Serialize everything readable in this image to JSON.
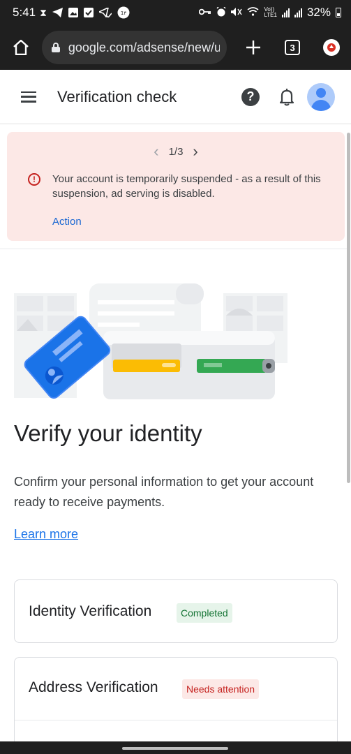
{
  "status_bar": {
    "time": "5:41",
    "volte": "Vo))\nLTE1",
    "battery_pct": "32%",
    "notification_icons": [
      "hourglass-icon",
      "telegram-icon",
      "gallery-icon",
      "checkbox-icon",
      "send-check-icon",
      "badge-icon"
    ],
    "system_icons": [
      "key-icon",
      "alarm-icon",
      "mute-icon",
      "wifi-icon",
      "signal-icon",
      "battery-icon"
    ]
  },
  "browser": {
    "url": "google.com/adsense/new/u",
    "tab_count": "3"
  },
  "app_bar": {
    "title": "Verification check"
  },
  "alert": {
    "pager": "1/3",
    "message": "Your account is temporarily suspended - as a result of this suspension, ad serving is disabled.",
    "action_label": "Action",
    "color": "#fce8e6"
  },
  "main": {
    "heading": "Verify your identity",
    "description": "Confirm your personal information to get your account ready to receive payments.",
    "learn_more": "Learn more"
  },
  "cards": [
    {
      "title": "Identity Verification",
      "status": "Completed",
      "status_color": "#137333"
    },
    {
      "title": "Address Verification",
      "status": "Needs attention",
      "status_color": "#c5221f"
    }
  ],
  "colors": {
    "accent": "#1a73e8",
    "status_bar": "#1f1f1f"
  }
}
